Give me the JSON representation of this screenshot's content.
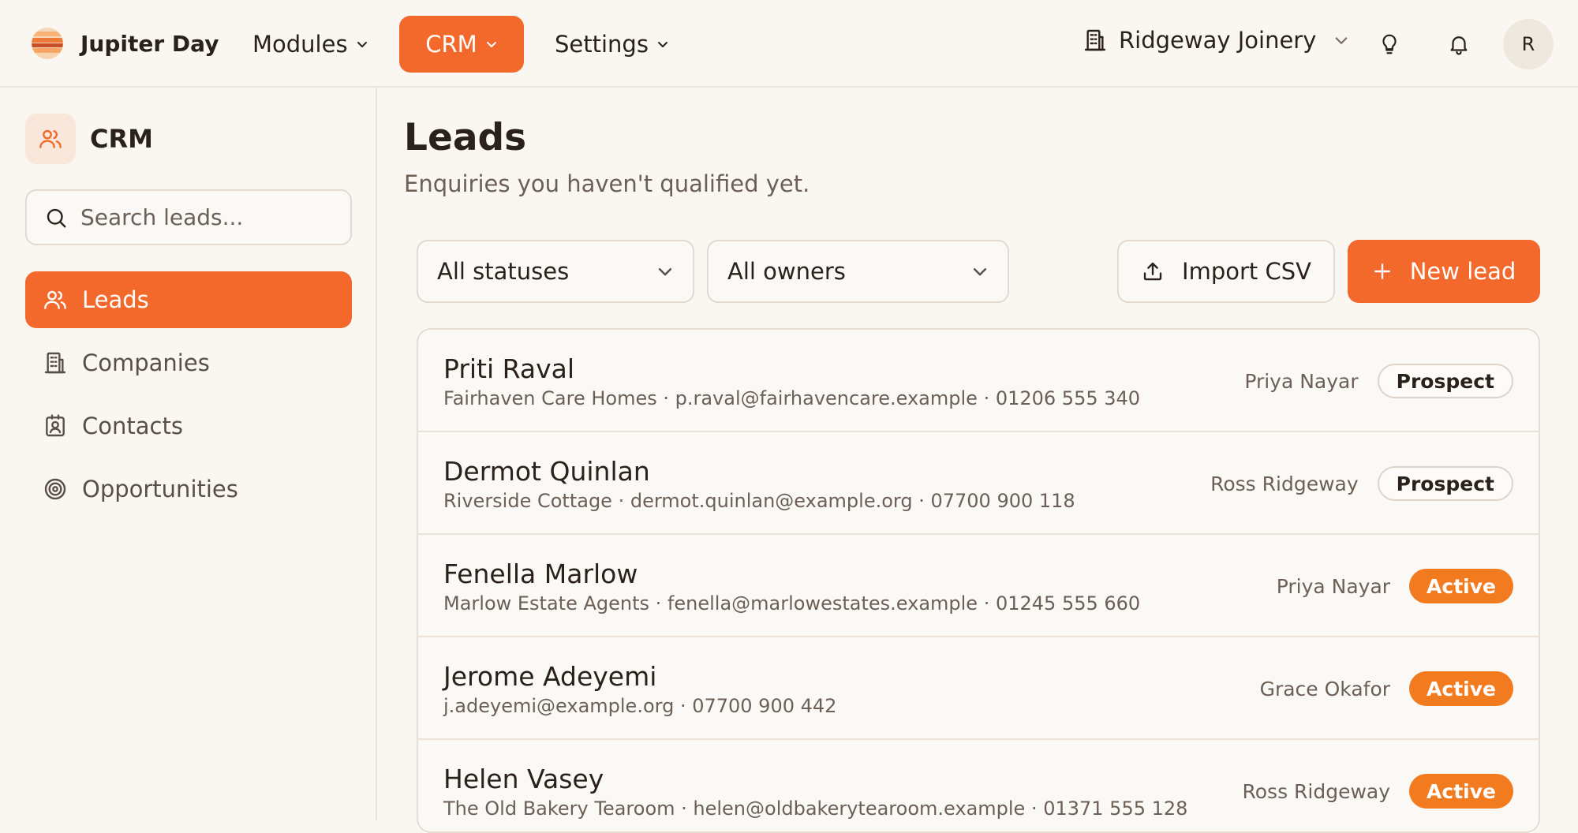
{
  "app": {
    "name": "Jupiter Day"
  },
  "topnav": {
    "modules": "Modules",
    "crm": "CRM",
    "settings": "Settings",
    "organization": "Ridgeway Joinery",
    "avatar_initial": "R"
  },
  "sidebar": {
    "title": "CRM",
    "search_placeholder": "Search leads...",
    "items": [
      {
        "label": "Leads",
        "icon": "users-icon",
        "active": true
      },
      {
        "label": "Companies",
        "icon": "building-icon",
        "active": false
      },
      {
        "label": "Contacts",
        "icon": "contact-card-icon",
        "active": false
      },
      {
        "label": "Opportunities",
        "icon": "target-icon",
        "active": false
      }
    ]
  },
  "main": {
    "title": "Leads",
    "subtitle": "Enquiries you haven't qualified yet.",
    "filters": {
      "status": "All statuses",
      "owner": "All owners"
    },
    "import_label": "Import CSV",
    "new_label": "New lead"
  },
  "leads": [
    {
      "name": "Priti Raval",
      "meta": "Fairhaven Care Homes · p.raval@fairhavencare.example · 01206 555 340",
      "owner": "Priya Nayar",
      "status": "Prospect"
    },
    {
      "name": "Dermot Quinlan",
      "meta": "Riverside Cottage · dermot.quinlan@example.org · 07700 900 118",
      "owner": "Ross Ridgeway",
      "status": "Prospect"
    },
    {
      "name": "Fenella Marlow",
      "meta": "Marlow Estate Agents · fenella@marlowestates.example · 01245 555 660",
      "owner": "Priya Nayar",
      "status": "Active"
    },
    {
      "name": "Jerome Adeyemi",
      "meta": "j.adeyemi@example.org · 07700 900 442",
      "owner": "Grace Okafor",
      "status": "Active"
    },
    {
      "name": "Helen Vasey",
      "meta": "The Old Bakery Tearoom · helen@oldbakerytearoom.example · 01371 555 128",
      "owner": "Ross Ridgeway",
      "status": "Active"
    }
  ],
  "colors": {
    "accent": "#f2692b",
    "active_badge": "#f27a1f",
    "background": "#faf7f3"
  }
}
